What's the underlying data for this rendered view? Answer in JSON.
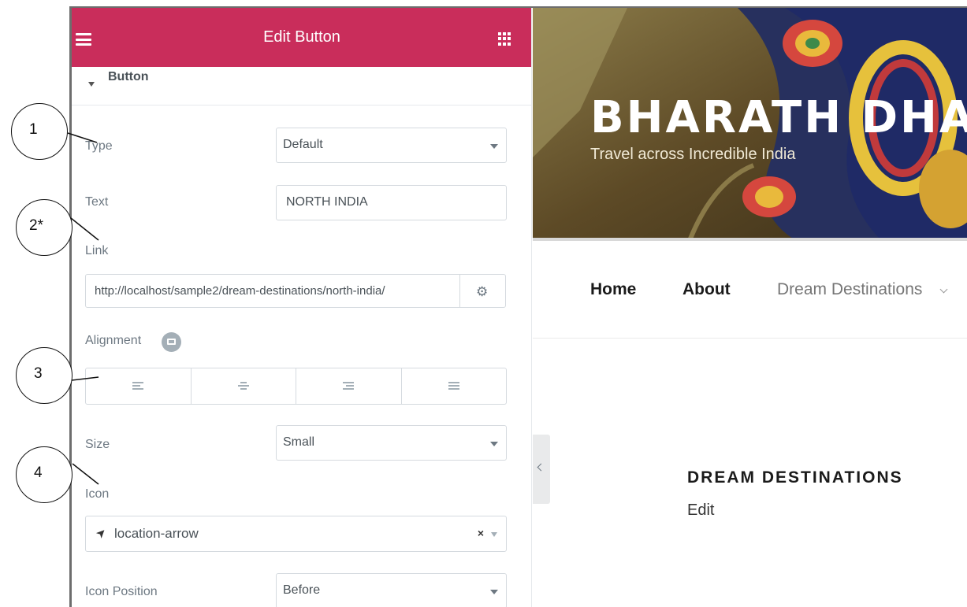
{
  "panel": {
    "title": "Edit Button",
    "section": "Button",
    "type": {
      "label": "Type",
      "value": "Default"
    },
    "text": {
      "label": "Text",
      "value": "NORTH INDIA"
    },
    "link": {
      "label": "Link",
      "value": "http://localhost/sample2/dream-destinations/north-india/"
    },
    "alignment": {
      "label": "Alignment",
      "options": [
        "left",
        "center",
        "right",
        "justified"
      ]
    },
    "size": {
      "label": "Size",
      "value": "Small"
    },
    "icon": {
      "label": "Icon",
      "value": "location-arrow",
      "glyph": "➤",
      "clear": "×"
    },
    "icon_position": {
      "label": "Icon Position",
      "value": "Before"
    }
  },
  "callouts": [
    "1",
    "2*",
    "3",
    "4"
  ],
  "preview": {
    "site_title": "BHARATH DHAR",
    "tagline": "Travel across Incredible India",
    "nav": [
      "Home",
      "About",
      "Dream Destinations"
    ],
    "heading": "DREAM DESTINATIONS",
    "edit": "Edit"
  },
  "colors": {
    "header": "#c92d5b",
    "hero": "#4b3a20"
  }
}
